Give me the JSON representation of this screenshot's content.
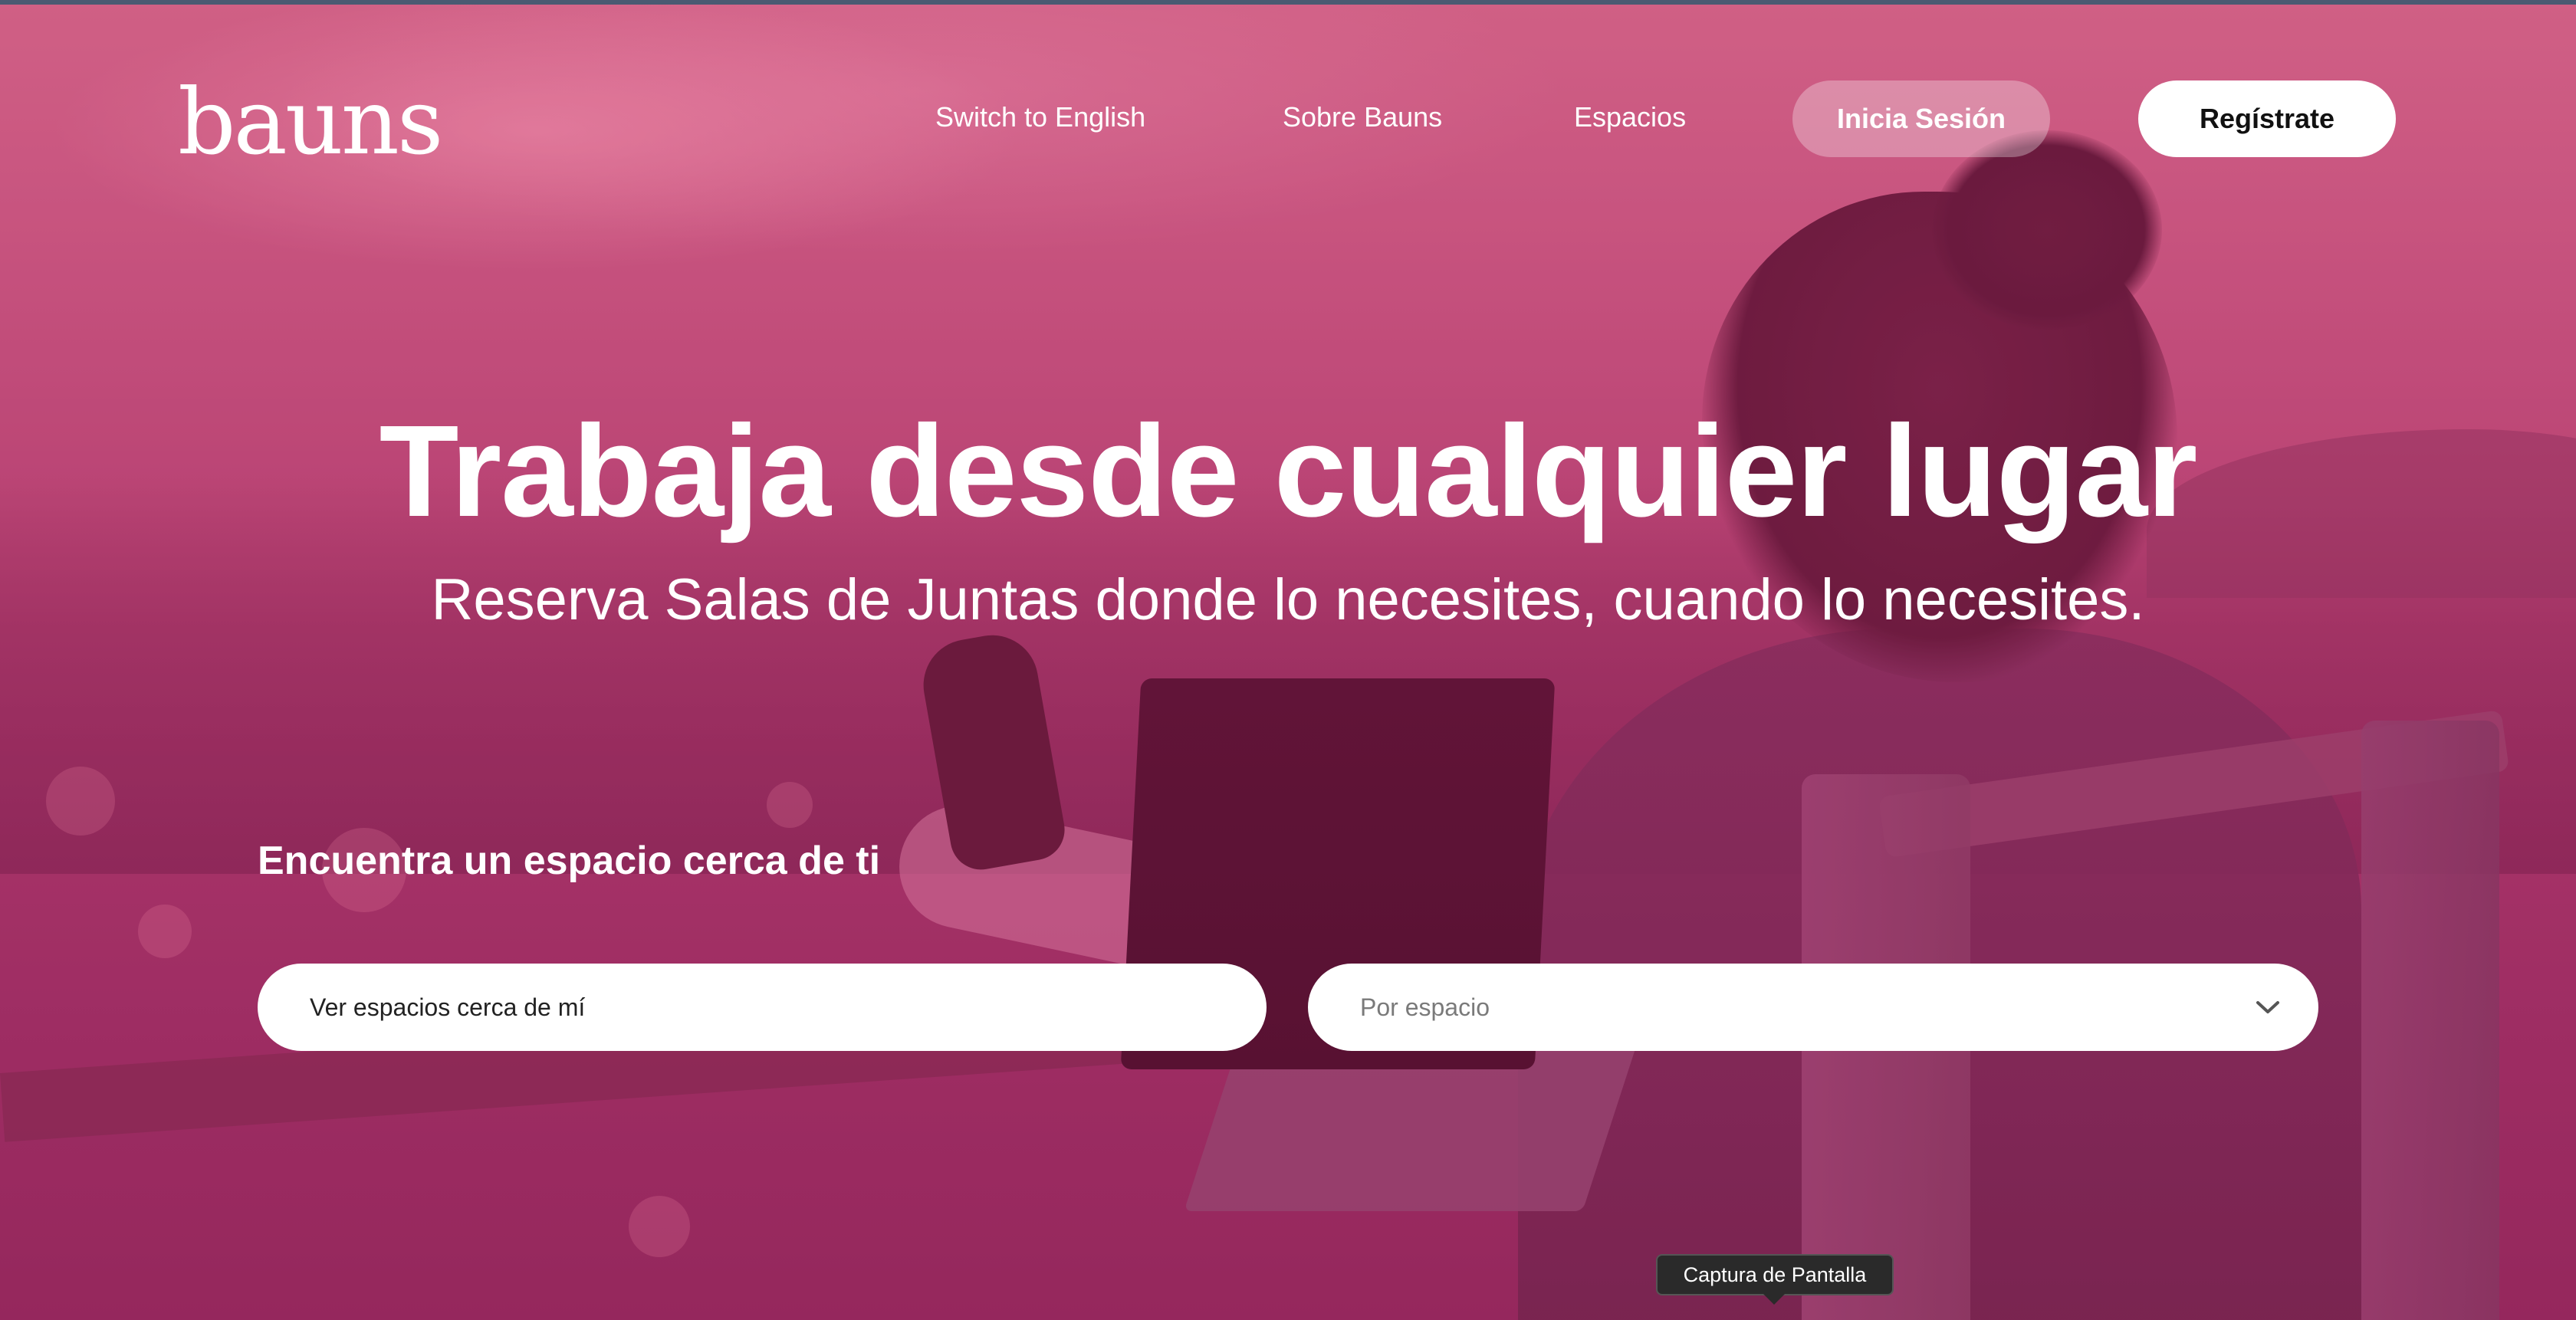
{
  "brand": {
    "logo_text": "bauns"
  },
  "nav": {
    "links": [
      {
        "label": "Switch to English"
      },
      {
        "label": "Sobre Bauns"
      },
      {
        "label": "Espacios"
      }
    ],
    "login_label": "Inicia Sesión",
    "register_label": "Regístrate"
  },
  "hero": {
    "title": "Trabaja desde cualquier lugar",
    "subtitle": "Reserva Salas de Juntas donde lo necesites, cuando lo necesites."
  },
  "search": {
    "heading": "Encuentra un espacio cerca de ti",
    "location_value": "Ver espacios cerca de mí",
    "space_select": {
      "placeholder": "Por espacio",
      "icon": "chevron-down-icon"
    }
  },
  "tooltip": {
    "text": "Captura de Pantalla"
  },
  "colors": {
    "overlay": "#b8446f",
    "button_light": "#ffffff",
    "text_light": "#ffffff"
  }
}
